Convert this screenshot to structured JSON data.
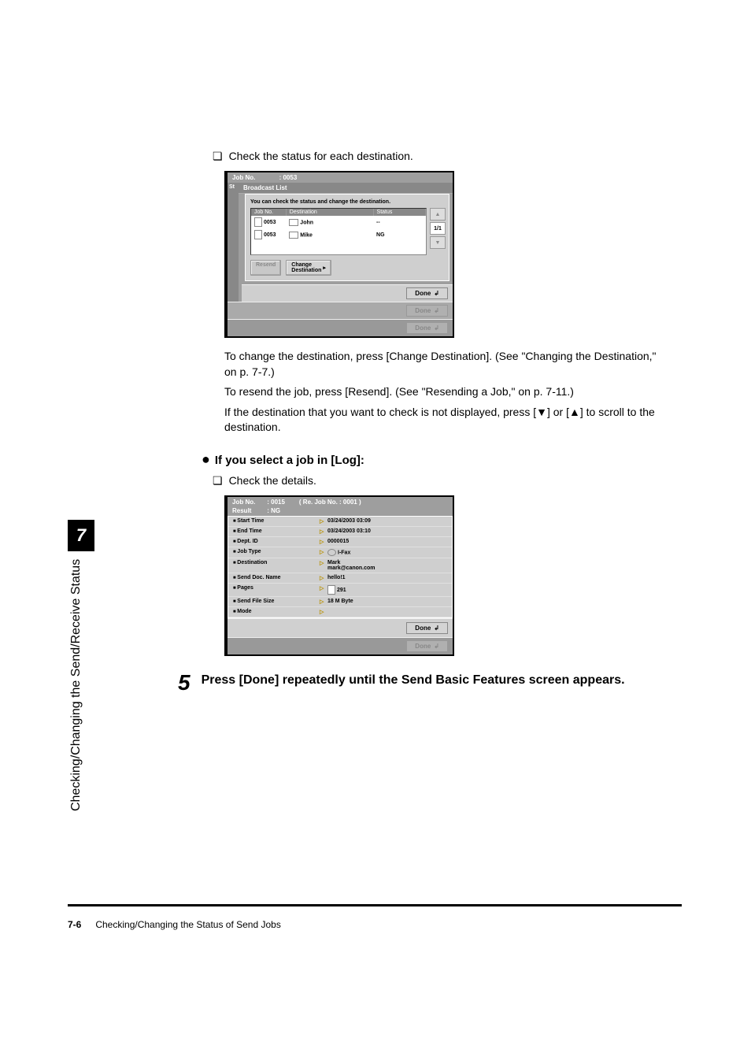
{
  "sidebar": {
    "chapter_number": "7",
    "vertical_label": "Checking/Changing the Send/Receive Status"
  },
  "bullet1": "Check the status for each destination.",
  "screenshot1": {
    "header_label": "Job No.",
    "header_value": ": 0053",
    "sub_label": "St",
    "subheader": "Broadcast List",
    "hint": "You can check the status and change the destination.",
    "col_jobno": "Job No.",
    "col_dest": "Destination",
    "col_status": "Status",
    "rows": [
      {
        "job": "0053",
        "dest": "John",
        "status": "--"
      },
      {
        "job": "0053",
        "dest": "Mike",
        "status": "NG"
      }
    ],
    "scroll_counter": "1/1",
    "btn_resend": "Resend",
    "btn_change": "Change\nDestination",
    "done": "Done"
  },
  "para1": "To change the destination, press [Change Destination]. (See \"Changing the Destination,\" on p. 7-7.)",
  "para2": "To resend the job, press [Resend]. (See \"Resending a Job,\" on p. 7-11.)",
  "para3a": "If the destination that you want to check is not displayed, press [",
  "para3b": "] or [",
  "para3c": "] to scroll to the destination.",
  "subheading": "If you select a job in [Log]:",
  "bullet2": "Check the details.",
  "screenshot2": {
    "hdr_job_lbl": "Job No.",
    "hdr_job_val": ": 0015",
    "hdr_re_lbl": "( Re. Job No.",
    "hdr_re_val": ": 0001 )",
    "hdr_res_lbl": "Result",
    "hdr_res_val": ": NG",
    "rows": [
      {
        "k": "Start Time",
        "v": "03/24/2003 03:09"
      },
      {
        "k": "End Time",
        "v": "03/24/2003 03:10"
      },
      {
        "k": "Dept. ID",
        "v": "0000015"
      },
      {
        "k": "Job Type",
        "v": "I-Fax",
        "icon": "ifax"
      },
      {
        "k": "Destination",
        "v": "Mark\nmark@canon.com"
      },
      {
        "k": "Send Doc. Name",
        "v": "hello!1"
      },
      {
        "k": "Pages",
        "v": "291",
        "icon": "page"
      },
      {
        "k": "Send File Size",
        "v": "18 M Byte"
      },
      {
        "k": "Mode",
        "v": ""
      }
    ],
    "done": "Done"
  },
  "step5_num": "5",
  "step5_text": "Press [Done] repeatedly until the Send Basic Features screen appears.",
  "footer": {
    "page": "7-6",
    "title": "Checking/Changing the Status of Send Jobs"
  }
}
